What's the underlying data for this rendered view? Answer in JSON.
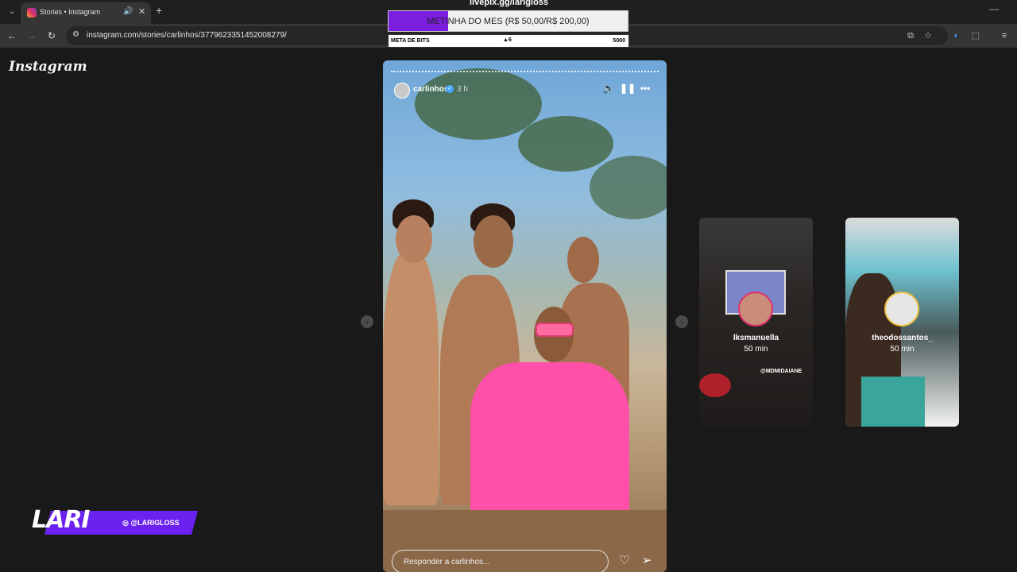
{
  "browser": {
    "tab_title": "Stories • Instagram",
    "url": "instagram.com/stories/carlinhos/3779623351452008279/"
  },
  "overlay": {
    "livepix": "livepix.gg/larigloss",
    "meta_mes": "METINHA DO MES (R$ 50,00/R$ 200,00)",
    "meta_progress": 0.25,
    "bits_label": "META DE BITS",
    "bits_current": "6",
    "bits_goal": "5000"
  },
  "instagram": {
    "logo": "Instagram",
    "story": {
      "username": "carlinhos",
      "time": "3 h",
      "reply_placeholder": "Responder a carlinhos..."
    },
    "previews": [
      {
        "username": "lksmanuella",
        "time": "50 min",
        "caption": "@MDMIDAIANE"
      },
      {
        "username": "theodossantos_",
        "time": "50 min"
      }
    ]
  },
  "streamer": {
    "name": "LARI",
    "handle": "@LARIGLOSS"
  },
  "colors": {
    "accent_purple": "#7b1ee0",
    "ig_story_ring": "#e1306c"
  }
}
